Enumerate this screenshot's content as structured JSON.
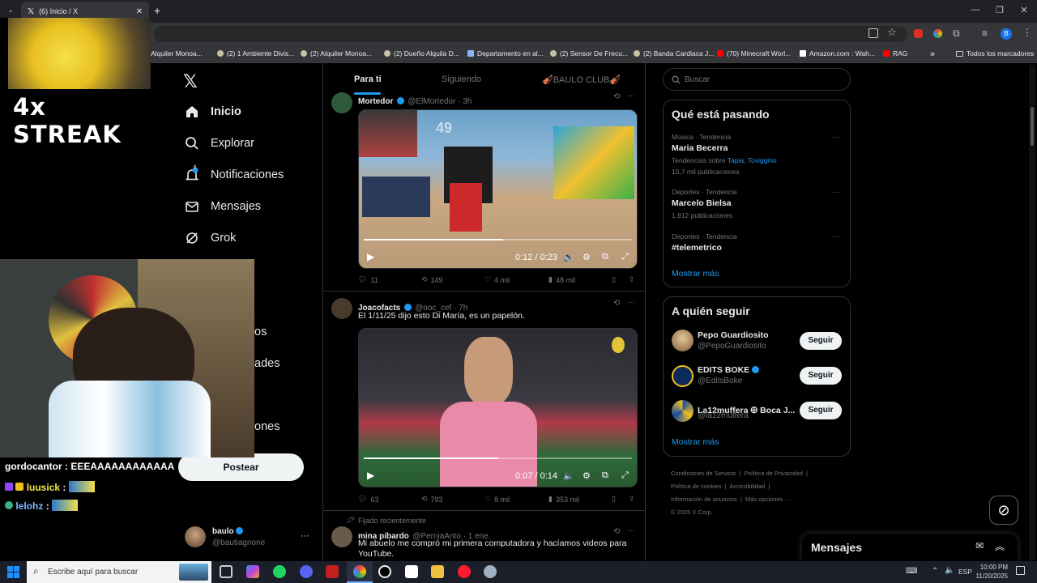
{
  "browser": {
    "tab_title": "(6) Inicio / X",
    "bookmarks": [
      "Alquiler Monoa...",
      "(2) 1 Ambiente Divis...",
      "(2) Alquiler Monoa...",
      "(2) Dueño Alquila D...",
      "Departamento en al...",
      "(2) Sensor De Frecu...",
      "(2) Banda Cardiaca J...",
      "(70) Minecraft Worl...",
      "Amazon.com : Wah...",
      "RAG"
    ],
    "all_bookmarks": "Todos los marcadores",
    "more_bookmarks": "»",
    "profile_initial": "B"
  },
  "nav": {
    "items": [
      "Inicio",
      "Explorar",
      "Notificaciones",
      "Mensajes",
      "Grok"
    ],
    "notif_badge": "6",
    "partial_items": [
      "os",
      "ades",
      "ones"
    ],
    "post_button": "Postear",
    "account": {
      "name": "baulo",
      "handle": "@bautiagnone",
      "more": "···"
    }
  },
  "feed": {
    "tabs": [
      "Para ti",
      "Siguiendo",
      "🎻BAULO CLUB🎻"
    ],
    "tweets": [
      {
        "name": "Mortedor",
        "handle": "@ElMortedor · 3h",
        "text": "",
        "video_time": "0:12 / 0:23",
        "replies": "11",
        "reposts": "149",
        "likes": "4 mil",
        "views": "48 mil",
        "video_overlay": "49"
      },
      {
        "name": "Joacofacts",
        "handle": "@ooc_cef · 7h",
        "text": "El 1/11/25 dijo esto Di María, es un papelón.",
        "video_time": "0:07 / 0:14",
        "replies": "63",
        "reposts": "793",
        "likes": "8 mil",
        "views": "353 mil"
      },
      {
        "pinned": "Fijado recientemente",
        "name": "mina pibardo",
        "handle": "@PerniaAnto · 1 ene.",
        "text": "Mi abuelo me compró mi primera computadora y hacíamos videos para YouTube."
      }
    ]
  },
  "sidebar": {
    "search_placeholder": "Buscar",
    "trends_title": "Qué está pasando",
    "trends": [
      {
        "meta": "Música · Tendencia",
        "title": "Maria Becerra",
        "sub_prefix": "Tendencias sobre ",
        "sub_links": "Tapia, Toviggino",
        "count": "10,7 mil publicaciones"
      },
      {
        "meta": "Deportes · Tendencia",
        "title": "Marcelo Bielsa",
        "count": "1.912 publicaciones"
      },
      {
        "meta": "Deportes · Tendencia",
        "title": "#telemetrico"
      }
    ],
    "show_more": "Mostrar más",
    "follow_title": "A quién seguir",
    "follow": [
      {
        "name": "Pepo Guardiosito",
        "handle": "@PepoGuardiosito",
        "button": "Seguir"
      },
      {
        "name": "EDITS BOKE",
        "handle": "@EditsBoke",
        "button": "Seguir"
      },
      {
        "name": "La12muffera 🜨 Boca J...",
        "handle": "@la12muffera",
        "button": "Seguir"
      }
    ],
    "follow_more": "Mostrar más",
    "footer": [
      "Condiciones de Servicio",
      "Política de Privacidad",
      "Política de cookies",
      "Accesibilidad",
      "Información de anuncios",
      "Más opciones ···",
      "© 2025 X Corp."
    ],
    "messages": "Mensajes"
  },
  "overlay": {
    "streak": "4x STREAK",
    "chat": [
      {
        "user": "gordocantor",
        "text": "EEEAAAAAAAAAAAA"
      },
      {
        "user": "luusick",
        "text": ""
      },
      {
        "user": "lelohz",
        "text": ""
      }
    ]
  },
  "taskbar": {
    "search_placeholder": "Escribe aquí para buscar",
    "lang": "ESP",
    "time": "10:00 PM",
    "date": "11/20/2025"
  }
}
